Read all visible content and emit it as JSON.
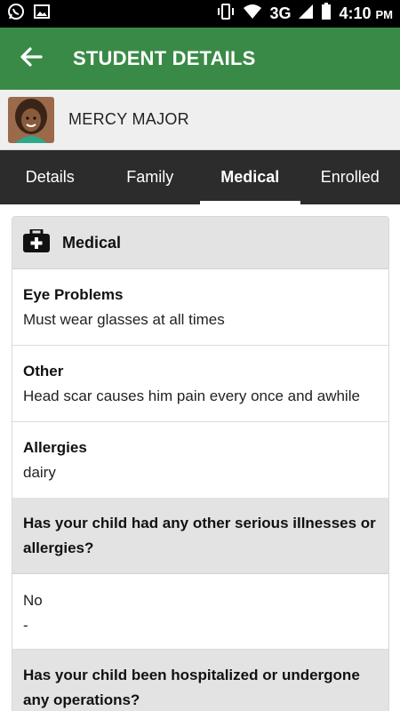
{
  "status_bar": {
    "network": "3G",
    "time": "4:10",
    "ampm": "PM",
    "icons": [
      "whatsapp-icon",
      "image-icon",
      "vibrate-icon",
      "wifi-icon",
      "signal-icon",
      "battery-icon"
    ]
  },
  "app_bar": {
    "title": "STUDENT DETAILS",
    "back_icon": "arrow-back-icon",
    "color": "#3a8a47"
  },
  "student": {
    "name": "MERCY  MAJOR"
  },
  "tabs": [
    {
      "label": "Details",
      "active": false
    },
    {
      "label": "Family",
      "active": false
    },
    {
      "label": "Medical",
      "active": true
    },
    {
      "label": "Enrolled",
      "active": false
    }
  ],
  "medical": {
    "header": "Medical",
    "items": [
      {
        "label": "Eye Problems",
        "value": "Must wear glasses at all times"
      },
      {
        "label": "Other",
        "value": "Head scar causes him pain every once and awhile"
      },
      {
        "label": "Allergies",
        "value": "dairy"
      }
    ],
    "questions": [
      {
        "question": "Has your child had any other serious illnesses or allergies?",
        "answer": "No",
        "detail": "-"
      },
      {
        "question": "Has your child been hospitalized or undergone any operations?"
      }
    ]
  }
}
